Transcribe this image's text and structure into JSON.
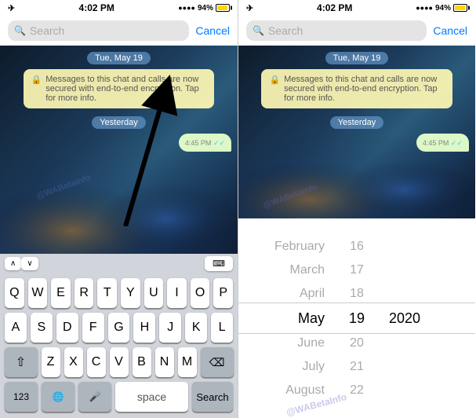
{
  "left_panel": {
    "status_bar": {
      "left": "✈",
      "time": "4:02 PM",
      "signal": "●●●●",
      "battery_pct": "94%"
    },
    "search": {
      "placeholder": "Search",
      "cancel_label": "Cancel"
    },
    "date_badge": "Tue, May 19",
    "system_message": "Messages to this chat and calls are now secured with end-to-end encryption. Tap for more info.",
    "yesterday_badge": "Yesterday",
    "message_time": "4:45 PM",
    "keyboard": {
      "row1": [
        "Q",
        "W",
        "E",
        "R",
        "T",
        "Y",
        "U",
        "I",
        "O",
        "P"
      ],
      "row2": [
        "A",
        "S",
        "D",
        "F",
        "G",
        "H",
        "J",
        "K",
        "L"
      ],
      "row3": [
        "Z",
        "X",
        "C",
        "V",
        "B",
        "N",
        "M"
      ],
      "space_label": "space",
      "search_label": "Search",
      "num_label": "123",
      "globe_label": "🌐",
      "mic_label": "🎤"
    },
    "toolbar": {
      "chevron_up": "∧",
      "chevron_down": "∨",
      "keyboard_icon": "⌨"
    },
    "watermark": "@WABetaInfo"
  },
  "right_panel": {
    "status_bar": {
      "left": "✈",
      "time": "4:02 PM",
      "battery_pct": "94%"
    },
    "search": {
      "placeholder": "Search",
      "cancel_label": "Cancel"
    },
    "date_badge": "Tue, May 19",
    "system_message": "Messages to this chat and calls are now secured with end-to-end encryption. Tap for more info.",
    "yesterday_badge": "Yesterday",
    "message_time": "4:45 PM",
    "picker": {
      "rows": [
        {
          "month": "February",
          "day": "16",
          "year": "",
          "selected": false
        },
        {
          "month": "March",
          "day": "17",
          "year": "",
          "selected": false
        },
        {
          "month": "April",
          "day": "18",
          "year": "",
          "selected": false
        },
        {
          "month": "May",
          "day": "19",
          "year": "2020",
          "selected": true
        },
        {
          "month": "June",
          "day": "20",
          "year": "",
          "selected": false
        },
        {
          "month": "July",
          "day": "21",
          "year": "",
          "selected": false
        },
        {
          "month": "August",
          "day": "22",
          "year": "",
          "selected": false
        }
      ]
    },
    "watermark": "@WABetaInfo"
  }
}
